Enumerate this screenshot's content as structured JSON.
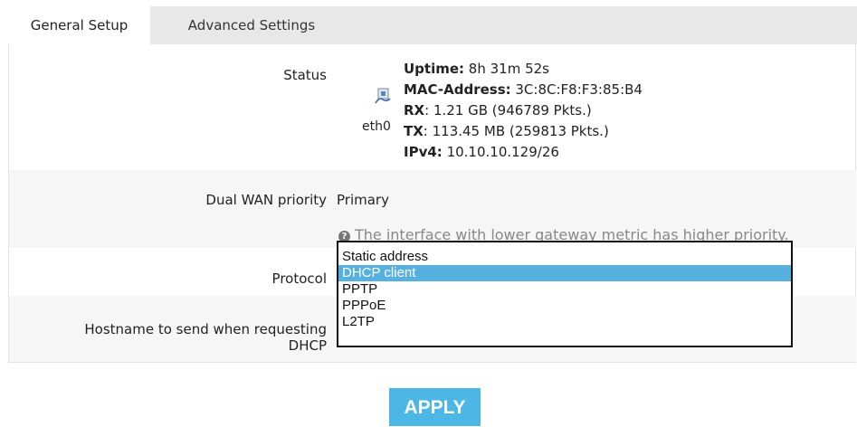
{
  "tabs": [
    {
      "label": "General Setup",
      "active": true
    },
    {
      "label": "Advanced Settings",
      "active": false
    }
  ],
  "status": {
    "label": "Status",
    "interface": "eth0",
    "interface_icon": "network-port-icon",
    "uptime_key": "Uptime:",
    "uptime_val": " 8h 31m 52s",
    "mac_key": "MAC-Address:",
    "mac_val": " 3C:8C:F8:F3:85:B4",
    "rx_key": "RX",
    "rx_val": ": 1.21 GB (946789 Pkts.)",
    "tx_key": "TX",
    "tx_val": ": 113.45 MB (259813 Pkts.)",
    "ipv4_key": "IPv4:",
    "ipv4_val": " 10.10.10.129/26"
  },
  "dual_wan": {
    "label": "Dual WAN priority",
    "value": "Primary",
    "help": "The interface with lower gateway metric has higher priority.",
    "help_icon": "question-circle-icon"
  },
  "protocol": {
    "label": "Protocol",
    "options": [
      "Static address",
      "DHCP client",
      "PPTP",
      "PPPoE",
      "L2TP"
    ],
    "selected": "DHCP client"
  },
  "hostname": {
    "label_line1": "Hostname to send when requesting",
    "label_line2": "DHCP"
  },
  "apply_label": "APPLY",
  "colors": {
    "accent": "#4cb6e5",
    "selected_option": "#57b1e0",
    "tabbar": "#e8e8e8",
    "row_alt": "#f6f6f6"
  }
}
